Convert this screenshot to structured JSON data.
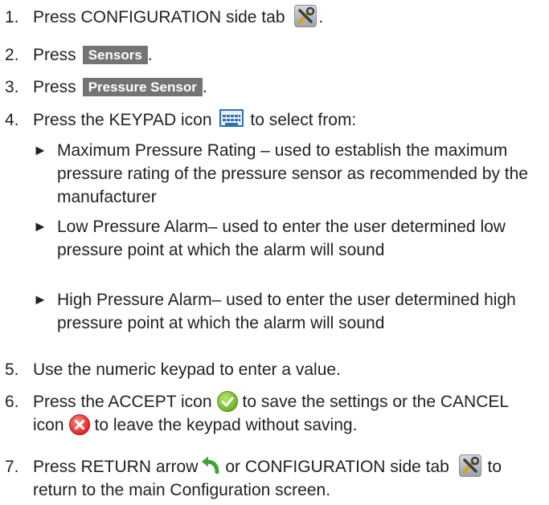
{
  "steps": [
    {
      "num": "1.",
      "pre": "Press CONFIGURATION side tab",
      "post": "."
    },
    {
      "num": "2.",
      "pre": "Press",
      "button": "Sensors",
      "post": "."
    },
    {
      "num": "3.",
      "pre": "Press",
      "button": "Pressure Sensor",
      "post": "."
    },
    {
      "num": "4.",
      "pre": "Press the KEYPAD icon",
      "post": "to select from:"
    },
    {
      "num": "5.",
      "text": "Use the numeric keypad to enter a value."
    },
    {
      "num": "6.",
      "pre": "Press the ACCEPT icon",
      "mid": "to save the settings or the CANCEL",
      "line2_pre": "icon",
      "line2_post": "to leave the keypad without saving."
    },
    {
      "num": "7.",
      "pre": "Press RETURN arrow",
      "mid": "or CONFIGURATION side tab",
      "post": "to",
      "line2": "return to the main Configuration screen."
    }
  ],
  "bullets": [
    {
      "line1": "Maximum Pressure Rating – used to establish the maximum",
      "line2": "pressure rating of the pressure sensor as recommended by the",
      "line3": "manufacturer"
    },
    {
      "line1": "Low Pressure Alarm– used to enter the user determined low",
      "line2": "pressure point at which the alarm will sound"
    },
    {
      "line1": "High Pressure Alarm– used to enter the user determined high",
      "line2": "pressure point at which the alarm will sound"
    }
  ],
  "bullet_marker": "►",
  "icons": {
    "configuration": "tools-icon",
    "keypad": "keypad-icon",
    "accept": "accept-check-icon",
    "cancel": "cancel-x-icon",
    "return": "return-arrow-icon"
  },
  "colors": {
    "button_bg": "#747474",
    "accept": "#6fb52a",
    "cancel": "#e3262a",
    "return_arrow": "#3aa535",
    "keypad_border": "#2f6fb3"
  }
}
